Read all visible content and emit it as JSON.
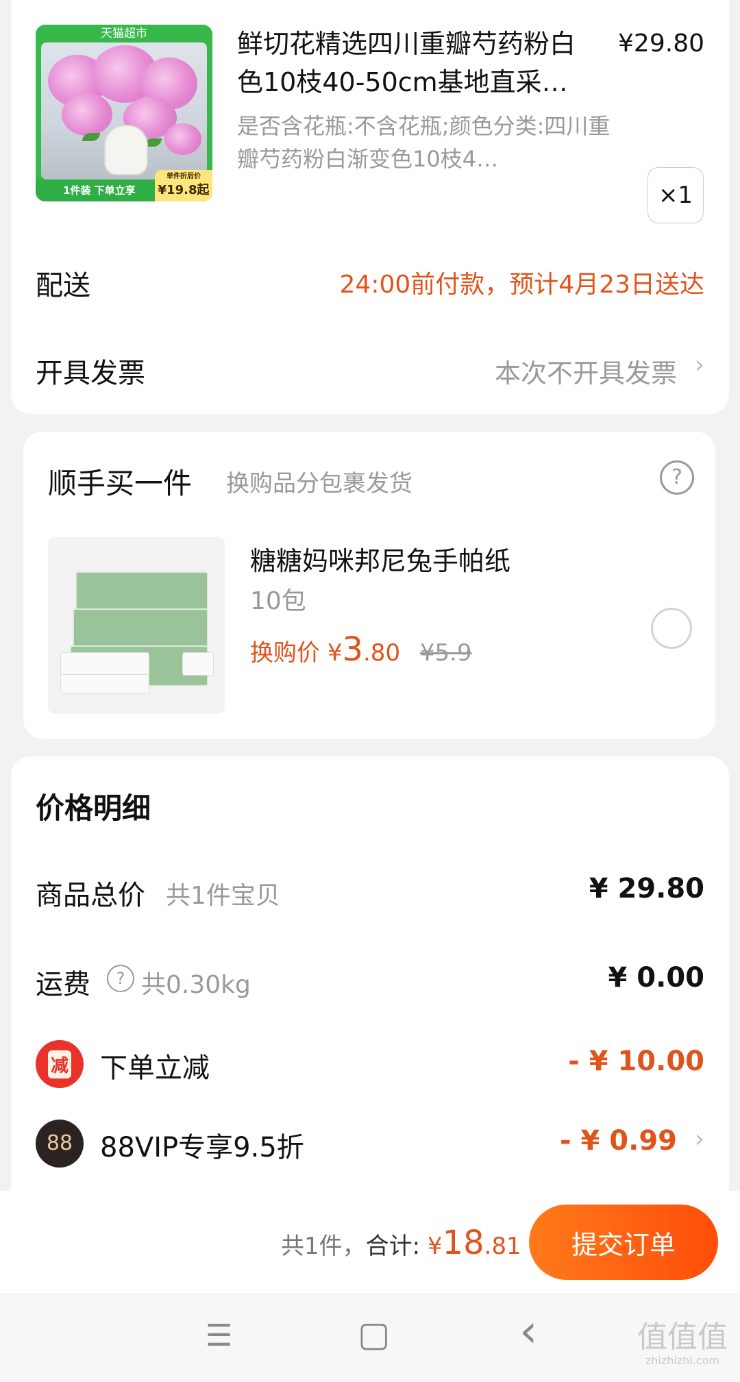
{
  "product": {
    "image_badge_top": "天猫超市",
    "image_badge_bottom_left": "1件装  下单立享",
    "image_badge_label": "单件折后价",
    "image_badge_price": "¥19.8起",
    "title": "鲜切花精选四川重瓣芍药粉白色10枝40-50cm基地直采…",
    "price": "¥29.80",
    "sku": "是否含花瓶:不含花瓶;颜色分类:四川重瓣芍药粉白渐变色10枝4…",
    "quantity": "×1"
  },
  "delivery": {
    "label": "配送",
    "value": "24:00前付款，预计4月23日送达"
  },
  "invoice": {
    "label": "开具发票",
    "value": "本次不开具发票"
  },
  "addon": {
    "title": "顺手买一件",
    "subtitle": "换购品分包裹发货",
    "item_name": "糖糖妈咪邦尼兔手帕纸",
    "item_spec": "10包",
    "price_label": "换购价",
    "price_symbol": "¥",
    "price_int": "3",
    "price_dec": ".80",
    "original_price": "¥5.9"
  },
  "price_detail": {
    "title": "价格明细",
    "goods_label": "商品总价",
    "goods_count": "共1件宝贝",
    "goods_value": "¥ 29.80",
    "shipping_label": "运费",
    "shipping_weight": "共0.30kg",
    "shipping_value": "¥ 0.00",
    "discount_icon": "减",
    "discount_label": "下单立减",
    "discount_value": "- ¥ 10.00",
    "vip_icon": "88",
    "vip_label": "88VIP专享9.5折",
    "vip_value": "- ¥ 0.99"
  },
  "footer": {
    "count_text": "共1件，",
    "total_label": "合计:",
    "total_symbol": "¥",
    "total_int": "18",
    "total_dec": ".81",
    "submit_label": "提交订单"
  },
  "nav": {
    "menu": "☰",
    "home": "▢",
    "back": "‹"
  },
  "watermark": {
    "text": "值值值",
    "url": "zhizhizhi.com"
  },
  "colors": {
    "accent": "#e0541c",
    "button": "#ff5a10",
    "tmall_green": "#36b84a"
  }
}
